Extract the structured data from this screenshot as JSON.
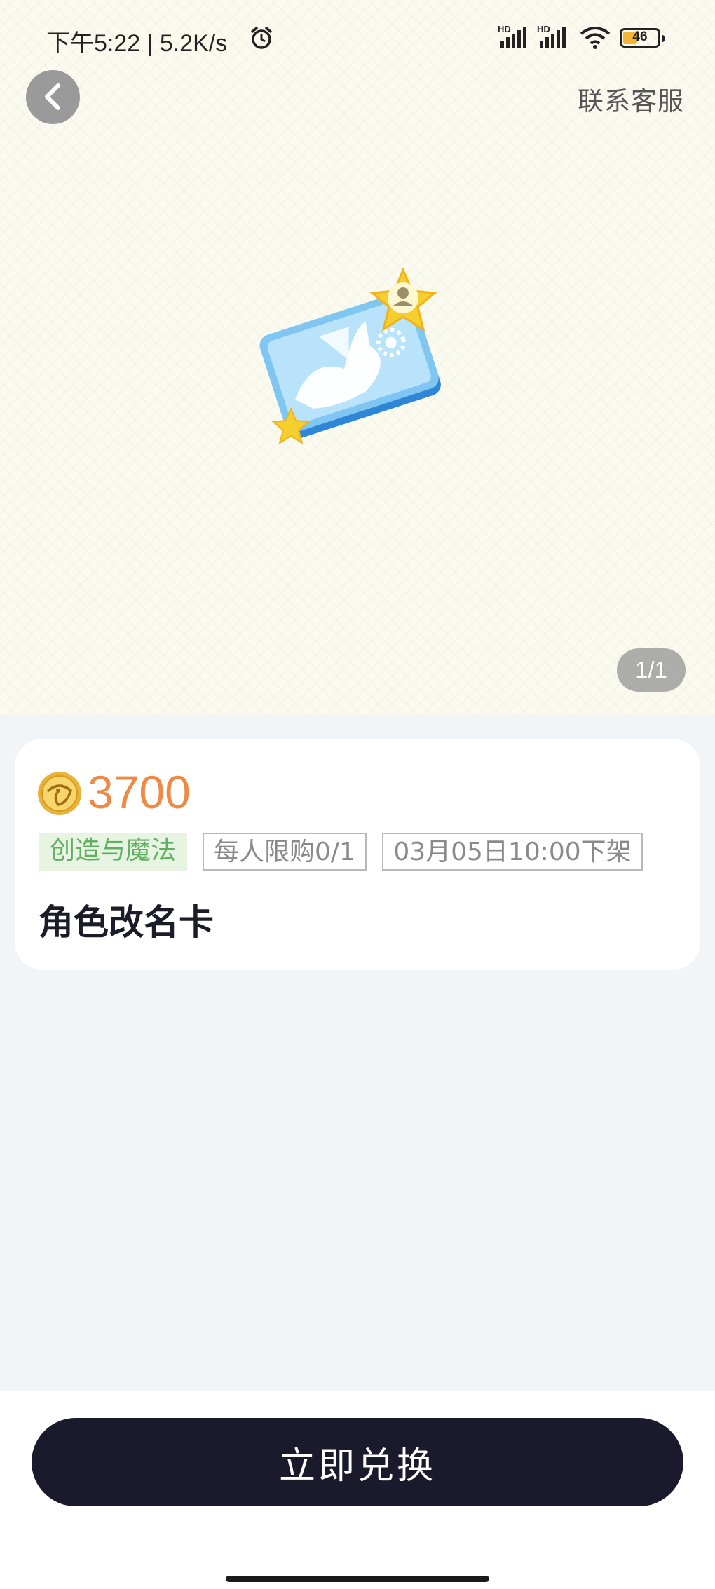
{
  "status_bar": {
    "time": "下午5:22 | 5.2K/s",
    "hd_label": "HD",
    "battery_level": "46",
    "battery_percent": 46
  },
  "header": {
    "contact_label": "联系客服"
  },
  "gallery": {
    "pager": "1/1"
  },
  "product": {
    "price": "3700",
    "tags": {
      "category": "创造与魔法",
      "limit": "每人限购0/1",
      "offline": "03月05日10:00下架"
    },
    "name": "角色改名卡"
  },
  "actions": {
    "redeem_label": "立即兑换"
  },
  "colors": {
    "price": "#ee8a46",
    "button": "#1b1a2c",
    "category_tag": "#5fae62"
  }
}
